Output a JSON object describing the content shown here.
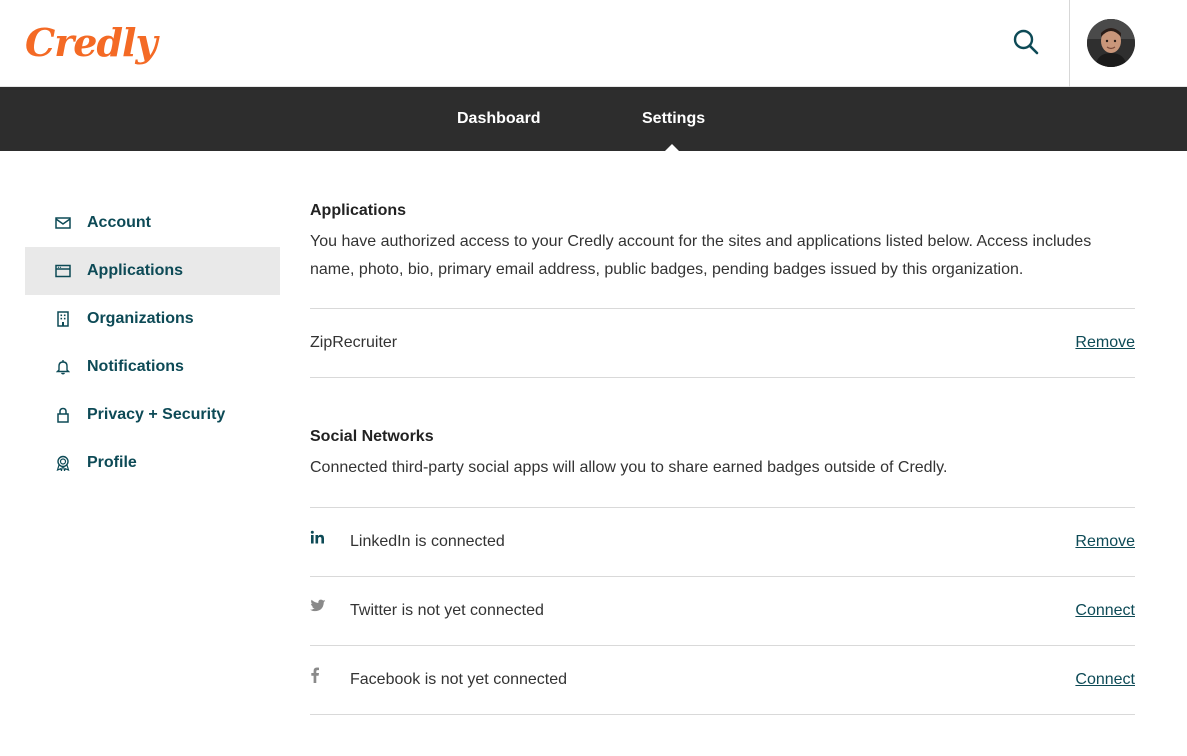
{
  "header": {
    "logo_text": "Credly",
    "brand_color": "#f46a25",
    "search_icon": "search-icon",
    "avatar_alt": "User avatar"
  },
  "nav": {
    "tabs": [
      {
        "label": "Dashboard",
        "active": false
      },
      {
        "label": "Settings",
        "active": true
      }
    ]
  },
  "sidebar": {
    "items": [
      {
        "label": "Account",
        "icon": "envelope-icon",
        "active": false
      },
      {
        "label": "Applications",
        "icon": "browser-window-icon",
        "active": true
      },
      {
        "label": "Organizations",
        "icon": "building-icon",
        "active": false
      },
      {
        "label": "Notifications",
        "icon": "bell-icon",
        "active": false
      },
      {
        "label": "Privacy + Security",
        "icon": "lock-icon",
        "active": false
      },
      {
        "label": "Profile",
        "icon": "badge-icon",
        "active": false
      }
    ]
  },
  "applications": {
    "title": "Applications",
    "description": "You have authorized access to your Credly account for the sites and applications listed below. Access includes name, photo, bio, primary email address, public badges, pending badges issued by this organization.",
    "items": [
      {
        "name": "ZipRecruiter",
        "action": "Remove"
      }
    ]
  },
  "social": {
    "title": "Social Networks",
    "description": "Connected third-party social apps will allow you to share earned badges outside of Credly.",
    "items": [
      {
        "icon": "linkedin-icon",
        "text": "LinkedIn is connected",
        "action": "Remove",
        "connected": true
      },
      {
        "icon": "twitter-icon",
        "text": "Twitter is not yet connected",
        "action": "Connect",
        "connected": false
      },
      {
        "icon": "facebook-icon",
        "text": "Facebook is not yet connected",
        "action": "Connect",
        "connected": false
      }
    ]
  },
  "colors": {
    "nav_bg": "#2d2d2d",
    "link": "#0d4a56",
    "active_sidebar_bg": "#e9e9e9"
  }
}
